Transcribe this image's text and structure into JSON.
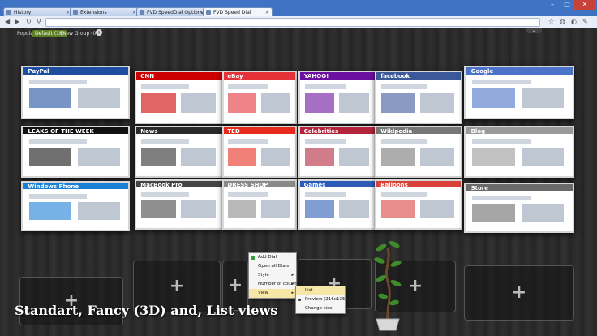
{
  "browser": {
    "tabs": [
      {
        "label": "History",
        "active": false
      },
      {
        "label": "Extensions",
        "active": false
      },
      {
        "label": "FVD SpeedDial Options",
        "active": false
      },
      {
        "label": "FVD Speed Dial",
        "active": true
      }
    ],
    "window_controls": {
      "minimize": "–",
      "maximize": "□",
      "close": "✕"
    }
  },
  "groups": [
    {
      "label": "Popular",
      "active": false
    },
    {
      "label": "Default (18)",
      "active": true
    },
    {
      "label": "New Group (0)",
      "active": false
    }
  ],
  "dials": [
    {
      "site": "PayPal",
      "accent": "#1f4ea0"
    },
    {
      "site": "CNN",
      "accent": "#cc0000"
    },
    {
      "site": "eBay",
      "accent": "#e53238"
    },
    {
      "site": "YAHOO!",
      "accent": "#6b0fa0"
    },
    {
      "site": "facebook",
      "accent": "#3b5998"
    },
    {
      "site": "Google",
      "accent": "#4a73c9"
    },
    {
      "site": "LEAKS OF THE WEEK",
      "accent": "#111111"
    },
    {
      "site": "News",
      "accent": "#2a2a2a"
    },
    {
      "site": "TED",
      "accent": "#e62b1e"
    },
    {
      "site": "Celebrities",
      "accent": "#b3243a"
    },
    {
      "site": "Wikipedia",
      "accent": "#777777"
    },
    {
      "site": "Blog",
      "accent": "#9a9a9a"
    },
    {
      "site": "Windows Phone",
      "accent": "#1c7fd6"
    },
    {
      "site": "MacBook Pro",
      "accent": "#444444"
    },
    {
      "site": "DRESS SHOP",
      "accent": "#8a8a8a"
    },
    {
      "site": "Games",
      "accent": "#2d5bb8"
    },
    {
      "site": "Balloons",
      "accent": "#d9413b"
    },
    {
      "site": "Store",
      "accent": "#6a6a6a"
    }
  ],
  "empty_slot_symbol": "+",
  "context_menu": {
    "items": [
      {
        "label": "Add Dial",
        "submenu": false
      },
      {
        "label": "Open all Dials",
        "submenu": false
      },
      {
        "label": "Style",
        "submenu": true
      },
      {
        "label": "Number of columns",
        "submenu": true
      },
      {
        "label": "View",
        "submenu": true
      }
    ],
    "submenu": [
      {
        "label": "List",
        "selected": false
      },
      {
        "label": "Preview (216x135)",
        "selected": true
      },
      {
        "label": "Change size",
        "selected": false
      }
    ]
  },
  "caption": "Standart, Fancy (3D) and,  List views",
  "icons": [
    "back-icon",
    "forward-icon",
    "reload-icon",
    "search-icon",
    "star-icon",
    "wrench-icon",
    "add-dial-icon",
    "plus-icon"
  ]
}
